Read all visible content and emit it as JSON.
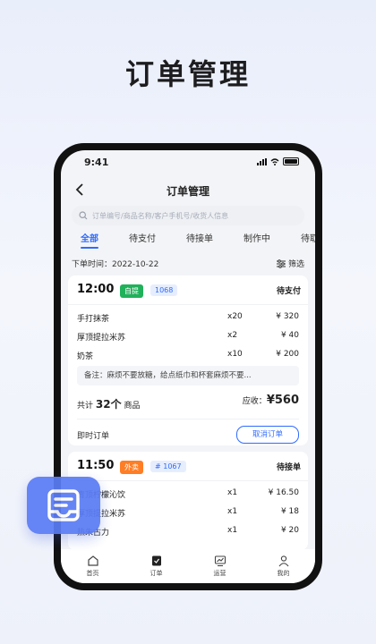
{
  "hero_title": "订单管理",
  "status": {
    "time": "9:41"
  },
  "nav": {
    "title": "订单管理"
  },
  "search": {
    "placeholder": "订单编号/商品名称/客户手机号/收货人信息"
  },
  "tabs": [
    "全部",
    "待支付",
    "待接单",
    "制作中",
    "待取"
  ],
  "filter": {
    "date_label": "下单时间：2022-10-22",
    "button": "筛选"
  },
  "orders": [
    {
      "time": "12:00",
      "type": "自提",
      "number": "1068",
      "status": "待支付",
      "items": [
        {
          "name": "手打抹茶",
          "qty": "x20",
          "price": "¥ 320"
        },
        {
          "name": "厚顶提拉米苏",
          "qty": "x2",
          "price": "¥ 40"
        },
        {
          "name": "奶茶",
          "qty": "x10",
          "price": "¥ 200"
        }
      ],
      "note": "备注：麻烦不要放糖，给点纸巾和杯套麻烦不要...",
      "total_prefix": "共计",
      "total_count": "32个",
      "total_suffix": "商品",
      "receivable_label": "应收：",
      "receivable": "¥560",
      "order_kind": "即时订单",
      "cancel_label": "取消订单"
    },
    {
      "time": "11:50",
      "type": "外卖",
      "number": "# 1067",
      "status": "待接单",
      "items": [
        {
          "name": "青顶柠檬沁饮",
          "qty": "x1",
          "price": "¥ 16.50"
        },
        {
          "name": "厚顶提拉米苏",
          "qty": "x1",
          "price": "¥ 18"
        },
        {
          "name": "热朱古力",
          "qty": "x1",
          "price": "¥ 20"
        }
      ]
    }
  ],
  "tabbar": [
    "首页",
    "订单",
    "运营",
    "我的"
  ],
  "colors": {
    "accent": "#2f6bff",
    "self_pickup": "#20b15a",
    "delivery": "#ff7d24",
    "float_icon": "#5b7cf5"
  }
}
